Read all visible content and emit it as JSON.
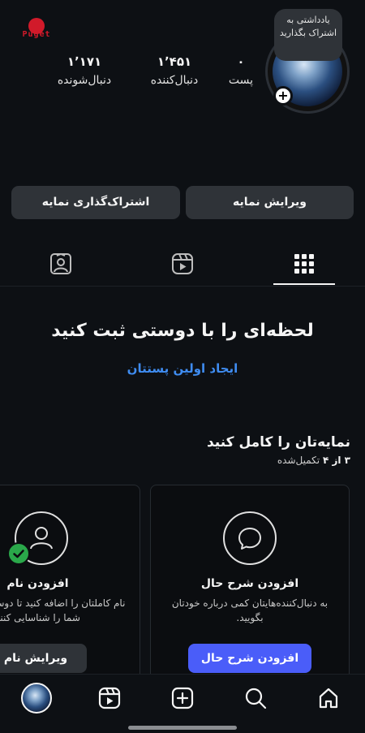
{
  "watermark": {
    "text": "Puget"
  },
  "profile": {
    "note": "یادداشتی به اشتراک بگذارید",
    "add_label": "+"
  },
  "stats": {
    "posts": {
      "value": "۰",
      "label": "پست"
    },
    "following": {
      "value": "۱٬۴۵۱",
      "label": "دنبال‌کننده"
    },
    "followers": {
      "value": "۱٬۱۷۱",
      "label": "دنبال‌شونده"
    }
  },
  "actions": {
    "edit_profile": "ویرایش نمایه",
    "share_profile": "اشتراک‌گذاری نمایه"
  },
  "tabs": [
    {
      "name": "grid",
      "icon": "grid-icon"
    },
    {
      "name": "reels",
      "icon": "reels-icon"
    },
    {
      "name": "tagged",
      "icon": "tagged-person-icon"
    }
  ],
  "empty_state": {
    "title": "لحظه‌ای را با دوستی ثبت کنید",
    "link": "ایجاد اولین پستتان"
  },
  "complete_profile": {
    "title": "نمایه‌تان را کامل کنید",
    "progress_count": "۳ از ۴",
    "progress_label": "تکمیل‌شده",
    "progress_fraction": 0.75,
    "cards": [
      {
        "icon": "speech-bubble-icon",
        "title": "افزودن شرح حال",
        "description": "به دنبال‌کننده‌هایتان کمی درباره خودتان بگویید.",
        "button": "افزودن شرح حال",
        "completed": false
      },
      {
        "icon": "person-icon",
        "title": "افزودن نام",
        "description": "نام کاملتان را اضافه کنید تا دوستانتان بدانند شما را شناسایی کنند",
        "button": "ویرایش نام",
        "completed": true
      }
    ]
  },
  "bottom_nav": [
    {
      "name": "home",
      "icon": "home-icon"
    },
    {
      "name": "search",
      "icon": "search-icon"
    },
    {
      "name": "create",
      "icon": "plus-square-icon"
    },
    {
      "name": "reels",
      "icon": "reels-icon"
    },
    {
      "name": "profile",
      "icon": "avatar"
    }
  ],
  "colors": {
    "background": "#0d1014",
    "button": "#2f3338",
    "link": "#3f8cf0",
    "primary_button": "#4a5df9",
    "success": "#2aa84a"
  }
}
